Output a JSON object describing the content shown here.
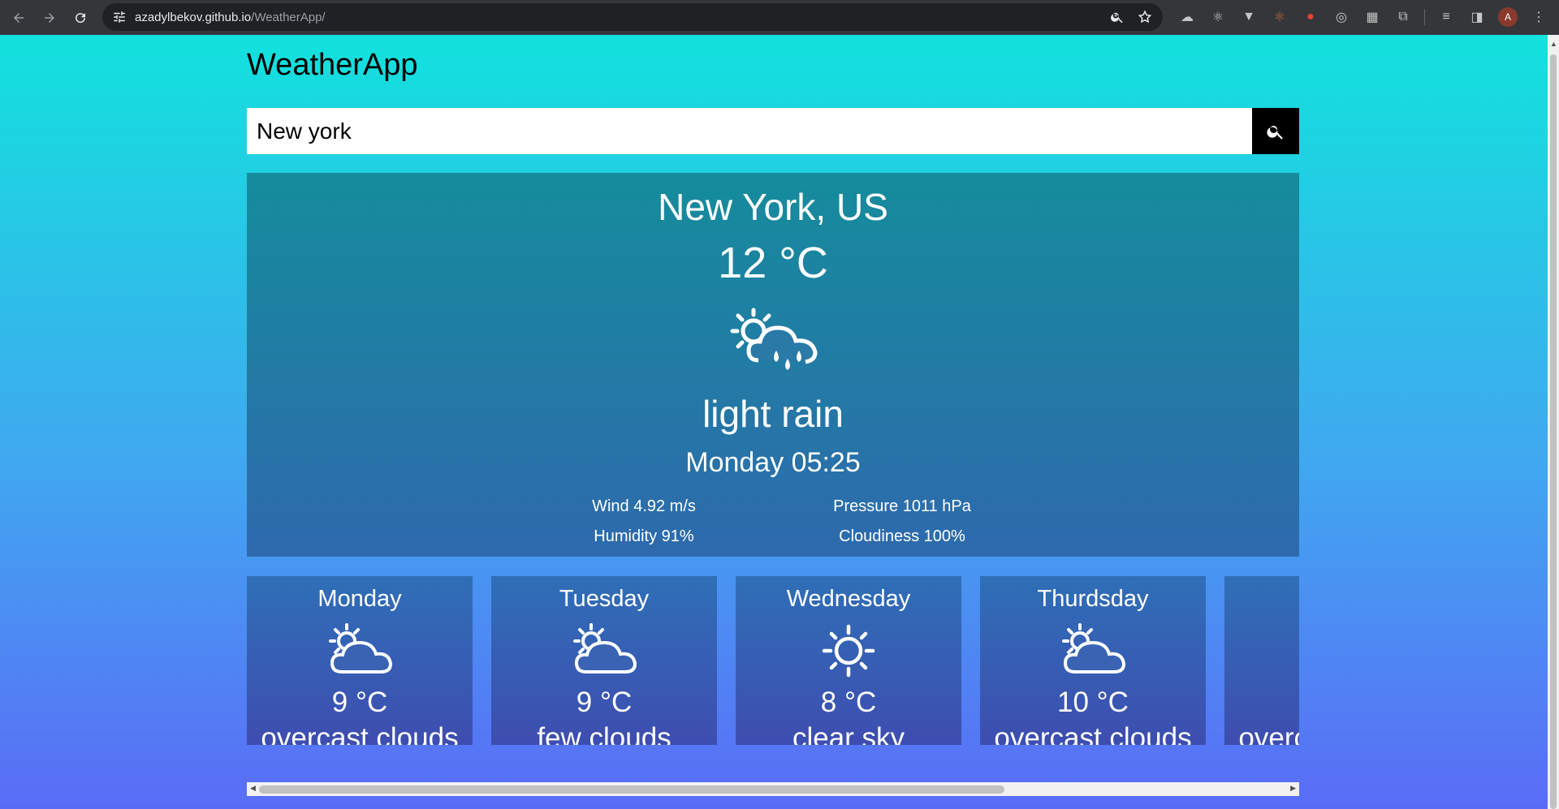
{
  "browser": {
    "url_host": "azadylbekov.github.io",
    "url_path": "/WeatherApp/",
    "avatar_letter": "A"
  },
  "app": {
    "title": "WeatherApp",
    "search_value": "New york"
  },
  "current": {
    "location": "New York, US",
    "temperature": "12 °C",
    "icon": "sun-cloud-rain-icon",
    "description": "light rain",
    "datetime": "Monday 05:25",
    "wind": "Wind 4.92 m/s",
    "pressure": "Pressure 1011 hPa",
    "humidity": "Humidity 91%",
    "cloudiness": "Cloudiness 100%"
  },
  "forecast": [
    {
      "day": "Monday",
      "temp": "9 °C",
      "desc": "overcast clouds",
      "icon": "sun-cloud-icon"
    },
    {
      "day": "Tuesday",
      "temp": "9 °C",
      "desc": "few clouds",
      "icon": "sun-cloud-icon"
    },
    {
      "day": "Wednesday",
      "temp": "8 °C",
      "desc": "clear sky",
      "icon": "sun-icon"
    },
    {
      "day": "Thurdsday",
      "temp": "10 °C",
      "desc": "overcast clouds",
      "icon": "sun-cloud-icon"
    },
    {
      "day": "",
      "temp": "",
      "desc": "overcast clouds",
      "icon": ""
    }
  ]
}
